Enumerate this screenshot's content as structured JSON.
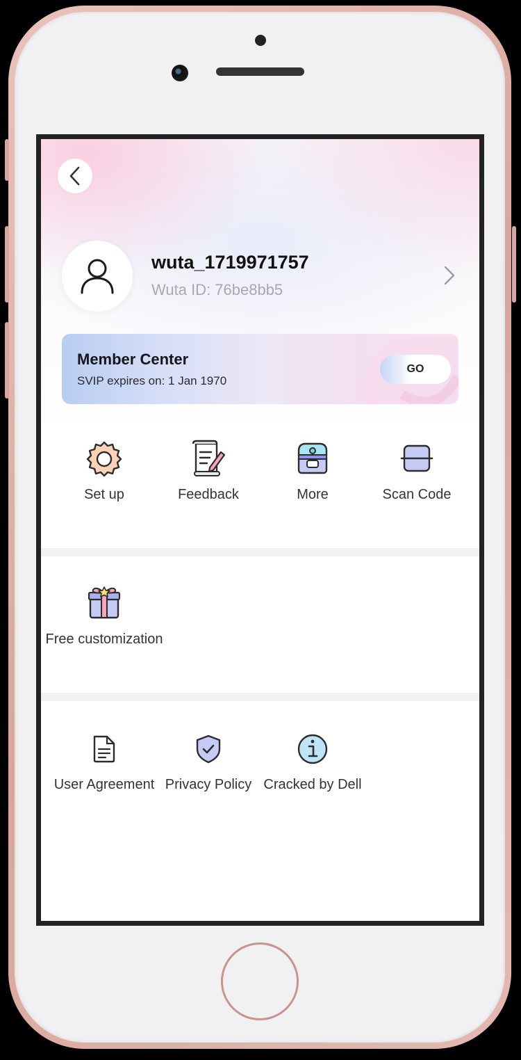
{
  "profile": {
    "username": "wuta_1719971757",
    "user_id": "Wuta ID: 76be8bb5"
  },
  "member": {
    "title": "Member Center",
    "subtitle": "SVIP expires on: 1 Jan 1970",
    "go_label": "GO"
  },
  "quick_actions": [
    {
      "label": "Set up",
      "icon": "gear-icon"
    },
    {
      "label": "Feedback",
      "icon": "scroll-pen-icon"
    },
    {
      "label": "More",
      "icon": "treasure-chest-icon"
    },
    {
      "label": "Scan Code",
      "icon": "scan-icon"
    }
  ],
  "extras": [
    {
      "label": "Free customization",
      "icon": "gift-box-icon"
    }
  ],
  "legal": [
    {
      "label": "User Agreement",
      "icon": "document-icon"
    },
    {
      "label": "Privacy Policy",
      "icon": "shield-check-icon"
    },
    {
      "label": "Cracked by Dell",
      "icon": "info-icon"
    }
  ],
  "colors": {
    "phone_body": "#e4b8b1",
    "accent_lavender": "#c6cbf5",
    "card_start": "#b9cdf3",
    "card_end": "#f8e2ef"
  }
}
